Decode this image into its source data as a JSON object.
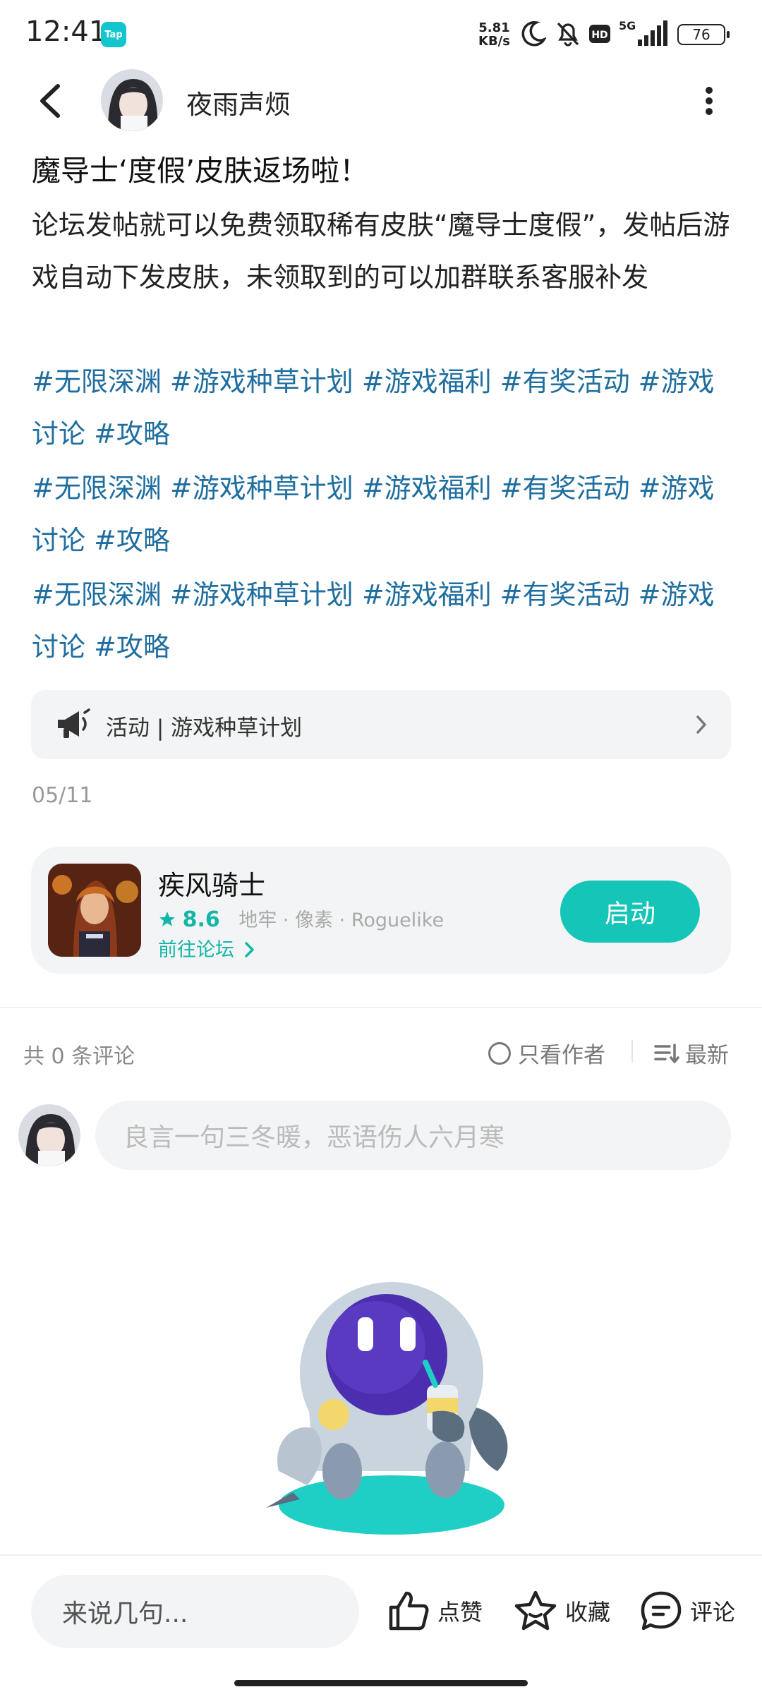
{
  "status_bar": {
    "time": "12:41",
    "app_badge": "Tap",
    "net_speed_value": "5.81",
    "net_speed_unit": "KB/s",
    "network": "5G",
    "hd": "HD",
    "battery": "76"
  },
  "header": {
    "author_name": "夜雨声烦"
  },
  "post": {
    "title": "魔导士‘度假’皮肤返场啦！",
    "body": "论坛发帖就可以免费领取稀有皮肤“魔导士度假”，发帖后游戏自动下发皮肤，未领取到的可以加群联系客服补发",
    "tag_lines": [
      "#无限深渊 #游戏种草计划 #游戏福利 #有奖活动 #游戏讨论 #攻略",
      "#无限深渊 #游戏种草计划 #游戏福利 #有奖活动 #游戏讨论 #攻略",
      "#无限深渊 #游戏种草计划 #游戏福利 #有奖活动 #游戏讨论 #攻略"
    ],
    "activity_label": "活动 | 游戏种草计划",
    "date": "05/11"
  },
  "game": {
    "name": "疾风骑士",
    "score": "8.6",
    "tags": "地牢 · 像素 · Roguelike",
    "forum_link": "前往论坛",
    "launch_label": "启动"
  },
  "comments": {
    "count_label": "共 0 条评论",
    "author_only_label": "只看作者",
    "sort_label": "最新",
    "input_placeholder": "良言一句三冬暖，恶语伤人六月寒"
  },
  "bottom_bar": {
    "say_placeholder": "来说几句...",
    "like_label": "点赞",
    "favorite_label": "收藏",
    "comment_label": "评论"
  },
  "colors": {
    "accent_teal": "#15c5b8",
    "tag_blue": "#1f6e9f",
    "card_bg": "#f3f4f5"
  }
}
